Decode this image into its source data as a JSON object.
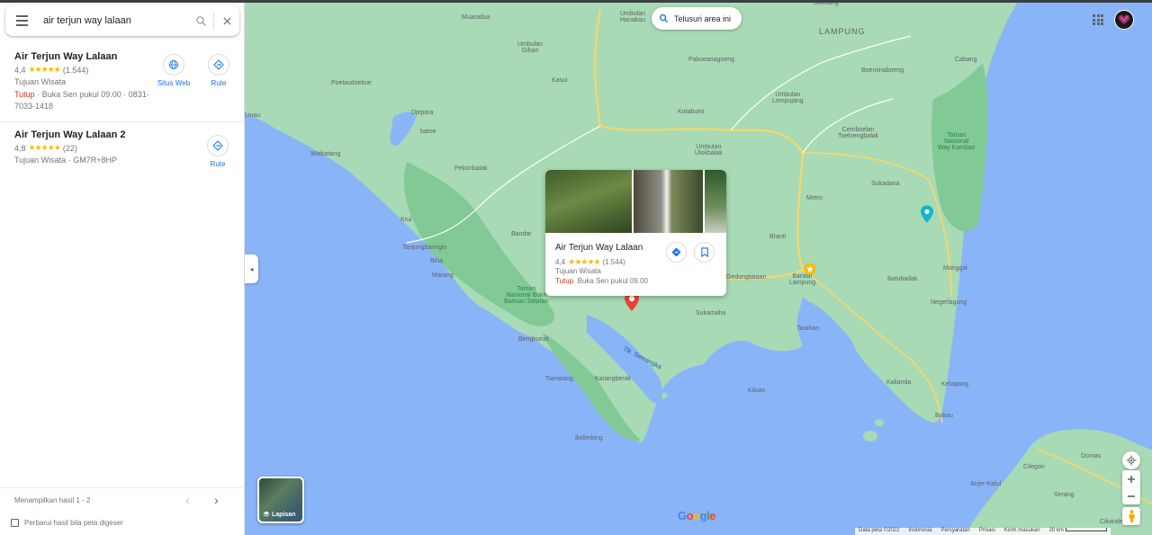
{
  "colors": {
    "land": "#a8dab5",
    "water": "#8ab4f8",
    "park": "#81c995",
    "road": "#fdd663",
    "accent": "#1a73e8",
    "closed": "#d93025",
    "star": "#fbbc04"
  },
  "search": {
    "query": "air terjun way lalaan"
  },
  "results": [
    {
      "title": "Air Terjun Way Lalaan",
      "rating": "4,4",
      "stars": "★★★★★",
      "reviews": "(1.544)",
      "category": "Tujuan Wisata",
      "status_closed": "Tutup",
      "status_rest": " · Buka Sen pukul 09.00 · 0831-7033-1418",
      "website_label": "Situs Web",
      "route_label": "Rute"
    },
    {
      "title": "Air Terjun Way Lalaan 2",
      "rating": "4,8",
      "stars": "★★★★★",
      "reviews": "(22)",
      "category": "Tujuan Wisata · GM7R+8HP",
      "route_label": "Rute"
    }
  ],
  "pager": {
    "text": "Menampilkan hasil 1 - 2",
    "prev": "‹",
    "next": "›"
  },
  "refresh_label": "Perbarui hasil bila peta digeser",
  "collapse": "◂",
  "map": {
    "search_area_label": "Telusuri area ini",
    "labels": {
      "muaradua": "Muaradua",
      "umbulan_hanakau": "Umbulan\nHanakau",
      "umbulan_gihan": "Umbulan\nGihan",
      "lampung": "LAMPUNG",
      "bakoang": "Bakoang",
      "kasui": "Kasui",
      "pakoeanagoeng": "Pakoeanagoeng",
      "boeminaboeng": "Boeminaboeng",
      "cabang": "Cabang",
      "poelaudoekoe": "Poelaudoekoe",
      "umbulan_lempujang": "Umbulan\nLempujang",
      "linau": "Linau",
      "djepara": "Djepara",
      "batoe": "batoe",
      "kotabumi": "Kotabumi",
      "cemboelan": "Cemboelan\nToeloengbalak",
      "taman_way_kambas": "Taman\nNasional\nWay Kambas",
      "waibatang": "Waibatang",
      "umbulan_ulokbalak": "Umbulan\nUlokbalak",
      "pekonbalak": "Pekonbalak",
      "sukadana": "Sukadana",
      "metro": "Metro",
      "krui": "Krui",
      "bandar": "Bandar",
      "branti": "Branti",
      "tanjungbaringin": "Tanjungbaringin",
      "biha": "Biha",
      "marang": "Marang",
      "manggai": "Manggai",
      "gedongtataan": "Gedongtataan",
      "bandar_lampung": "Bandar\nLampung",
      "batubadak": "Batubadak",
      "taman_bukit": "Taman\nNasional Bukit\nBarisan Selatan",
      "sukamaha": "Sukamaha",
      "negerlagung": "Negerlagung",
      "bengkunat": "Bengkunat",
      "tarahan": "Tarahan",
      "tlk_semangka": "Tlk. Semangka",
      "tiampang": "Tiampang",
      "karangberak": "Karangberak",
      "kiluan": "Kiluan",
      "kalianda": "Kalianda",
      "ketapang": "Ketapang",
      "bakau": "Bakau",
      "belimbing": "Belimbing",
      "cilegon": "Cilegon",
      "domas": "Domas",
      "anjer_kidul": "Anjer-Kidul",
      "serang": "Serang",
      "cikande": "Cikande"
    },
    "card": {
      "title": "Air Terjun Way Lalaan",
      "rating": "4,4",
      "stars": "★★★★★",
      "reviews": "(1.544)",
      "category": "Tujuan Wisata",
      "status_closed": "Tutup",
      "status_rest": "Buka Sen pukul 09.00"
    },
    "layers_label": "Lapisan",
    "google_logo": "Google",
    "footer": {
      "data": "Data peta ©2022",
      "country": "Indonesia",
      "terms": "Persyaratan",
      "privacy": "Privasi",
      "feedback": "Kirim masukan",
      "scale": "20 km"
    }
  }
}
